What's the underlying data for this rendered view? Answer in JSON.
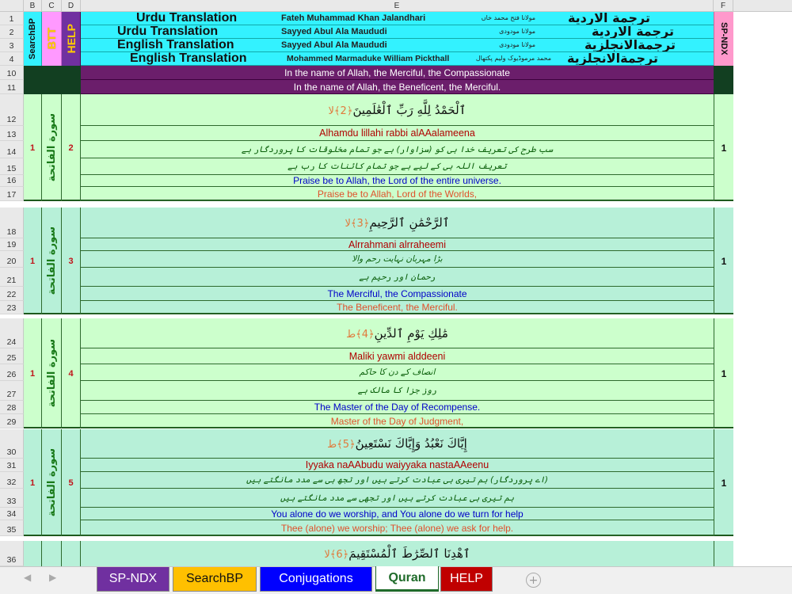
{
  "columns": {
    "a": "",
    "b": "B",
    "c": "C",
    "d": "D",
    "e": "E",
    "f": "F"
  },
  "row_numbers": [
    "1",
    "2",
    "3",
    "4",
    "10",
    "11",
    "12",
    "13",
    "14",
    "15",
    "16",
    "17",
    "18",
    "19",
    "20",
    "21",
    "22",
    "23",
    "24",
    "25",
    "26",
    "27",
    "28",
    "29",
    "30",
    "31",
    "32",
    "33",
    "34",
    "35",
    "36"
  ],
  "header": {
    "searchbp_label": "SearchBP",
    "btt_label": "BTT",
    "help_label": "HELP",
    "spndx_label": "SP-NDX",
    "rows": [
      {
        "title": "Urdu Translation",
        "translator": "Fateh Muhammad Khan Jalandhari",
        "translator_native": "مولانا فتح محمد خاں",
        "arabic_title": "ترجمة الاردية"
      },
      {
        "title": "Urdu Translation",
        "translator": "Sayyed Abul Ala Maududi",
        "translator_native": "مولانا مودودی",
        "arabic_title": "ترجمة الاردية"
      },
      {
        "title": "English Translation",
        "translator": "Sayyed Abul Ala Maududi",
        "translator_native": "مولانا مودودی",
        "arabic_title": "ترجمةالانجلزية"
      },
      {
        "title": "English Translation",
        "translator": "Mohammed Marmaduke William Pickthall",
        "translator_native": "محمد مرموڈیوک ولیم پکتھال",
        "arabic_title": "ترجمةالانجلزية"
      }
    ]
  },
  "basmala": {
    "line1": "In the name of Allah, the Merciful, the Compassionate",
    "line2": "In the name of Allah, the Beneficent, the Merciful."
  },
  "verses": [
    {
      "surah_no": "1",
      "surah_name": "سورة الفاتحة",
      "ayah_no": "2",
      "index": "1",
      "arabic": "ٱلْحَمْدُ لِلَّهِ رَبِّ ٱلْعَٰلَمِينَ",
      "marker": "﴿2﴾لا",
      "translit": "Alhamdu lillahi rabbi alAAalameena",
      "urdu1": "سب طرح کی تعریف خدا ہی کو (سزاوار) ہے جو تمام مخلوقات کا پروردگار ہے",
      "urdu2": "تعریف اللہ ہی کے لیے ہے جو تمام کائنات کا رب ہے",
      "en1": "Praise be to Allah, the Lord of the entire universe.",
      "en2": "Praise be to Allah, Lord of the Worlds,"
    },
    {
      "surah_no": "1",
      "surah_name": "سورة الفاتحة",
      "ayah_no": "3",
      "index": "1",
      "arabic": "ٱلرَّحْمَٰنِ ٱلرَّحِيمِ",
      "marker": "﴿3﴾لا",
      "translit": "Alrrahmani alrraheemi",
      "urdu1": "بڑا مہربان نہایت رحم والا",
      "urdu2": "رحمان اور رحیم ہے",
      "en1": "The Merciful, the Compassionate",
      "en2": "The Beneficent, the Merciful."
    },
    {
      "surah_no": "1",
      "surah_name": "سورة الفاتحة",
      "ayah_no": "4",
      "index": "1",
      "arabic": "مَٰلِكِ يَوْمِ ٱلدِّينِ",
      "marker": "﴿4﴾ط",
      "translit": "Maliki yawmi alddeeni",
      "urdu1": "انصاف کے دن کا حاکم",
      "urdu2": "روز جزا کا مالک ہے",
      "en1": "The Master of the Day of Recompense.",
      "en2": "Master of the Day of Judgment,"
    },
    {
      "surah_no": "1",
      "surah_name": "سورة الفاتحة",
      "ayah_no": "5",
      "index": "1",
      "arabic": "إِيَّاكَ نَعْبُدُ وَإِيَّاكَ نَسْتَعِينُ",
      "marker": "﴿5﴾ط",
      "translit": "Iyyaka naAAbudu waiyyaka nastaAAeenu",
      "urdu1": "(اے پروردگار) ہم تیری ہی عبادت کرتے ہیں اور تجھ ہی سے مدد مانگتے ہیں",
      "urdu2": "ہم تیری ہی عبادت کرتے ہیں اور تجھی سے مدد مانگتے ہیں",
      "en1": "You alone do we worship, and You alone do we turn for help",
      "en2": "Thee (alone) we worship; Thee (alone) we ask for help."
    }
  ],
  "partial_row": {
    "arabic": "ٱهْدِنَا ٱلصِّرَٰطَ ٱلْمُسْتَقِيمَ",
    "marker": "﴿6﴾لا"
  },
  "tabs": [
    {
      "label": "SP-NDX",
      "bg": "#7030a0",
      "color": "#ffffff"
    },
    {
      "label": "SearchBP",
      "bg": "#ffc000",
      "color": "#111111"
    },
    {
      "label": "Conjugations",
      "bg": "#0000ff",
      "color": "#ffffff"
    },
    {
      "label": "Quran",
      "bg": "#ffffff",
      "color": "#1f6b2a"
    },
    {
      "label": "HELP",
      "bg": "#c00000",
      "color": "#ffffff"
    }
  ],
  "colors": {
    "cyan": "#33f2ff",
    "purple": "#6b1e6b",
    "dark": "#123f21",
    "light_green_a": "#ccffcc",
    "light_green_b": "#b7f0d8"
  }
}
